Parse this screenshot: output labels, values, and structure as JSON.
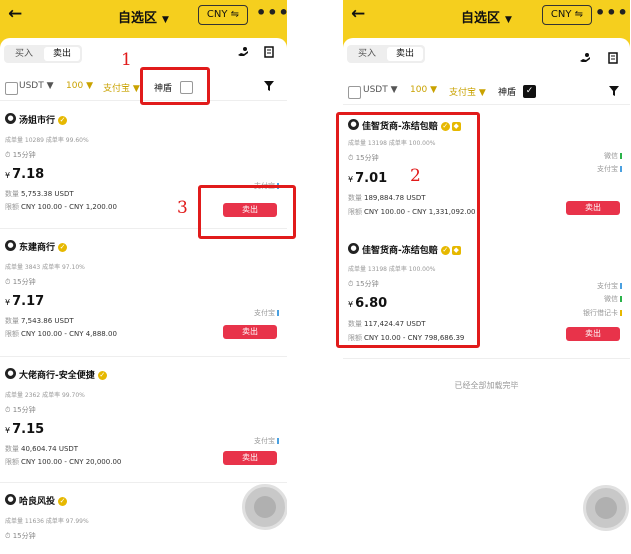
{
  "header": {
    "back_glyph": "←",
    "title": "自选区",
    "title_caret": "▼",
    "currency_button": "CNY ⇋",
    "more_glyph": "•••"
  },
  "tabs": {
    "buy": "买入",
    "sell": "卖出",
    "active": "sell"
  },
  "toolbar_icons": [
    "hand-coin-icon",
    "document-icon"
  ],
  "filters_left": {
    "coin": "USDT",
    "amount": "100",
    "payment": "支付宝",
    "shield_label": "神盾",
    "shield_checked": false,
    "caret": "▼"
  },
  "filters_right": {
    "coin": "USDT",
    "amount": "100",
    "payment": "支付宝",
    "shield_label": "神盾",
    "shield_checked": true,
    "caret": "▼"
  },
  "yen": "¥",
  "sell_label": "卖出",
  "listings_left": [
    {
      "name": "汤姐市行",
      "stats": "成单量 10289  成单率 99.60%",
      "time": "15分钟",
      "price": "7.18",
      "qty_label": "数量",
      "qty": "5,753.38 USDT",
      "limit_label": "限额",
      "limit": "CNY 100.00 - CNY 1,200.00",
      "payments": [
        "支付宝"
      ]
    },
    {
      "name": "东建商行",
      "stats": "成单量 3843  成单率 97.10%",
      "time": "15分钟",
      "price": "7.17",
      "qty_label": "数量",
      "qty": "7,543.86 USDT",
      "limit_label": "限额",
      "limit": "CNY 100.00 - CNY 4,888.00",
      "payments": [
        "支付宝"
      ]
    },
    {
      "name": "大佬商行-安全便捷",
      "stats": "成单量 2362  成单率 99.70%",
      "time": "15分钟",
      "price": "7.15",
      "qty_label": "数量",
      "qty": "40,604.74 USDT",
      "limit_label": "限额",
      "limit": "CNY 100.00 - CNY 20,000.00",
      "payments": [
        "支付宝"
      ]
    },
    {
      "name": "哈良风投",
      "stats": "成单量 11636  成单率 97.99%",
      "time": "15分钟"
    }
  ],
  "listings_right": [
    {
      "name": "佳智货商-冻结包赔",
      "stats": "成单量 13198  成单率 100.00%",
      "time": "15分钟",
      "price": "7.01",
      "qty_label": "数量",
      "qty": "189,884.78 USDT",
      "limit_label": "限额",
      "limit": "CNY 100.00 - CNY 1,331,092.00",
      "payments": [
        "微信",
        "支付宝"
      ]
    },
    {
      "name": "佳智货商-冻结包赔",
      "stats": "成单量 13198  成单率 100.00%",
      "time": "15分钟",
      "price": "6.80",
      "qty_label": "数量",
      "qty": "117,424.47 USDT",
      "limit_label": "限额",
      "limit": "CNY 10.00 - CNY 798,686.39",
      "payments": [
        "支付宝",
        "微信",
        "银行借记卡"
      ]
    }
  ],
  "all_loaded_text": "已经全部加载完毕",
  "annotations": {
    "one": "1",
    "two": "2",
    "three": "3"
  },
  "colors": {
    "brand_yellow": "#f5cf1e",
    "sell_red": "#e8334a",
    "annotation_red": "#e11b1b",
    "gold": "#c9a200"
  }
}
